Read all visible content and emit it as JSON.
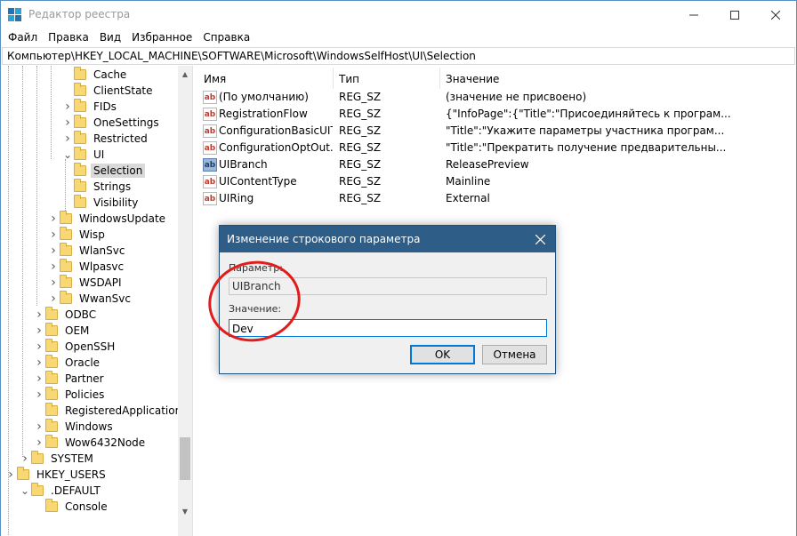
{
  "window": {
    "title": "Редактор реестра"
  },
  "menu": [
    "Файл",
    "Правка",
    "Вид",
    "Избранное",
    "Справка"
  ],
  "address": "Компьютер\\HKEY_LOCAL_MACHINE\\SOFTWARE\\Microsoft\\WindowsSelfHost\\UI\\Selection",
  "tree": [
    {
      "label": "Cache",
      "depth": 4,
      "chevron": ""
    },
    {
      "label": "ClientState",
      "depth": 4,
      "chevron": ""
    },
    {
      "label": "FIDs",
      "depth": 4,
      "chevron": ">"
    },
    {
      "label": "OneSettings",
      "depth": 4,
      "chevron": ">"
    },
    {
      "label": "Restricted",
      "depth": 4,
      "chevron": ">"
    },
    {
      "label": "UI",
      "depth": 4,
      "chevron": "v"
    },
    {
      "label": "Selection",
      "depth": 5,
      "chevron": "",
      "selected": true
    },
    {
      "label": "Strings",
      "depth": 5,
      "chevron": ""
    },
    {
      "label": "Visibility",
      "depth": 5,
      "chevron": ""
    },
    {
      "label": "WindowsUpdate",
      "depth": 3,
      "chevron": ">"
    },
    {
      "label": "Wisp",
      "depth": 3,
      "chevron": ">"
    },
    {
      "label": "WlanSvc",
      "depth": 3,
      "chevron": ">"
    },
    {
      "label": "Wlpasvc",
      "depth": 3,
      "chevron": ">"
    },
    {
      "label": "WSDAPI",
      "depth": 3,
      "chevron": ">"
    },
    {
      "label": "WwanSvc",
      "depth": 3,
      "chevron": ">"
    },
    {
      "label": "ODBC",
      "depth": 2,
      "chevron": ">"
    },
    {
      "label": "OEM",
      "depth": 2,
      "chevron": ">"
    },
    {
      "label": "OpenSSH",
      "depth": 2,
      "chevron": ">"
    },
    {
      "label": "Oracle",
      "depth": 2,
      "chevron": ">"
    },
    {
      "label": "Partner",
      "depth": 2,
      "chevron": ">"
    },
    {
      "label": "Policies",
      "depth": 2,
      "chevron": ">"
    },
    {
      "label": "RegisteredApplications",
      "depth": 2,
      "chevron": ""
    },
    {
      "label": "Windows",
      "depth": 2,
      "chevron": ">"
    },
    {
      "label": "Wow6432Node",
      "depth": 2,
      "chevron": ">"
    },
    {
      "label": "SYSTEM",
      "depth": 1,
      "chevron": ">"
    },
    {
      "label": "HKEY_USERS",
      "depth": 0,
      "chevron": ">"
    },
    {
      "label": ".DEFAULT",
      "depth": 1,
      "chevron": "v"
    },
    {
      "label": "Console",
      "depth": 2,
      "chevron": ""
    }
  ],
  "columns": {
    "name": "Имя",
    "type": "Тип",
    "value": "Значение"
  },
  "rows": [
    {
      "icon": "string-value-icon",
      "name": "(По умолчанию)",
      "type": "REG_SZ",
      "value": "(значение не присвоено)"
    },
    {
      "icon": "string-value-icon",
      "name": "RegistrationFlow",
      "type": "REG_SZ",
      "value": "{\"InfoPage\":{\"Title\":\"Присоединяйтесь к програм..."
    },
    {
      "icon": "string-value-icon",
      "name": "ConfigurationBasicUIT...",
      "type": "REG_SZ",
      "value": "\"Title\":\"Укажите параметры участника програм..."
    },
    {
      "icon": "string-value-icon",
      "name": "ConfigurationOptOut...",
      "type": "REG_SZ",
      "value": "\"Title\":\"Прекратить получение предварительны..."
    },
    {
      "icon": "string-value-icon",
      "name": "UIBranch",
      "type": "REG_SZ",
      "value": "ReleasePreview",
      "highlight": true
    },
    {
      "icon": "string-value-icon",
      "name": "UIContentType",
      "type": "REG_SZ",
      "value": "Mainline"
    },
    {
      "icon": "string-value-icon",
      "name": "UIRing",
      "type": "REG_SZ",
      "value": "External"
    }
  ],
  "dialog": {
    "title": "Изменение строкового параметра",
    "param_label": "Параметр:",
    "param_value": "UIBranch",
    "value_label": "Значение:",
    "value_input": "Dev",
    "ok": "OK",
    "cancel": "Отмена"
  },
  "annotation_color": "#e21b1b",
  "accent": "#2e5d87"
}
